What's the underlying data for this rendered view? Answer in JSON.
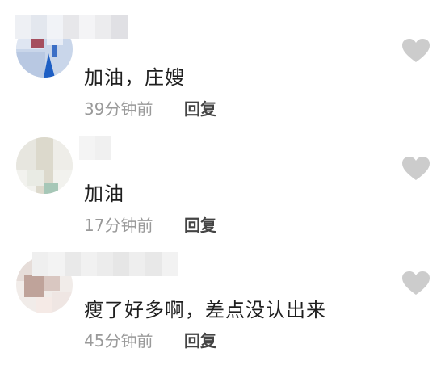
{
  "comments": [
    {
      "text": "加油，庄嫂",
      "time": "39分钟前",
      "reply_label": "回复"
    },
    {
      "text": "加油",
      "time": "17分钟前",
      "reply_label": "回复"
    },
    {
      "text": "瘦了好多啊，差点没认出来",
      "time": "45分钟前",
      "reply_label": "回复"
    }
  ],
  "colors": {
    "like_icon": "#cccccc",
    "meta_text": "#9a9a9a",
    "comment_text": "#1f1f1f"
  },
  "icons": {
    "like": "heart-icon"
  }
}
